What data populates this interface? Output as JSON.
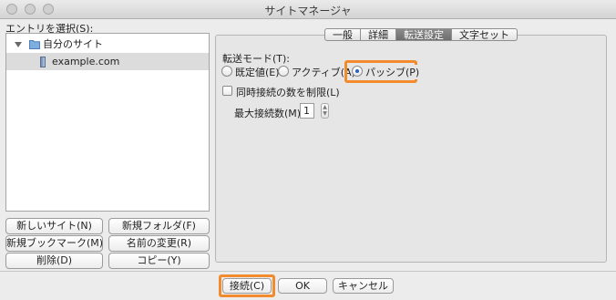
{
  "window": {
    "title": "サイトマネージャ"
  },
  "entry_label": "エントリを選択(S):",
  "tree": {
    "root": {
      "label": "自分のサイト",
      "icon": "folder-icon"
    },
    "children": [
      {
        "label": "example.com",
        "icon": "server-icon"
      }
    ]
  },
  "left_buttons": {
    "new_site": "新しいサイト(N)",
    "new_folder": "新規フォルダ(F)",
    "new_bookmark": "新規ブックマーク(M)",
    "rename": "名前の変更(R)",
    "delete": "削除(D)",
    "copy": "コピー(Y)"
  },
  "tabs": [
    {
      "label": "一般",
      "active": false
    },
    {
      "label": "詳細",
      "active": false
    },
    {
      "label": "転送設定",
      "active": true
    },
    {
      "label": "文字セット",
      "active": false
    }
  ],
  "transfer": {
    "mode_label": "転送モード(T):",
    "options": [
      {
        "label": "既定値(E)",
        "selected": false
      },
      {
        "label": "アクティブ(A)",
        "selected": false
      },
      {
        "label": "パッシブ(P)",
        "selected": true
      }
    ],
    "limit_label": "同時接続の数を制限(L)",
    "limit_checked": false,
    "max_label": "最大接続数(M):",
    "max_value": "1"
  },
  "bottom_buttons": {
    "connect": "接続(C)",
    "ok": "OK",
    "cancel": "キャンセル"
  },
  "colors": {
    "highlight": "#f28a2e",
    "radio_dot": "#2b5fb7"
  }
}
